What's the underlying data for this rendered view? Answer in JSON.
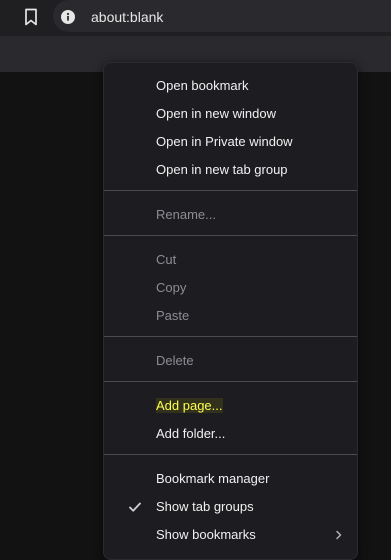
{
  "toolbar": {
    "url": "about:blank",
    "bookmark_icon": "bookmark-icon",
    "info_icon": "info-icon"
  },
  "menu": {
    "group1": [
      "Open bookmark",
      "Open in new window",
      "Open in Private window",
      "Open in new tab group"
    ],
    "rename": "Rename...",
    "edit": [
      "Cut",
      "Copy",
      "Paste"
    ],
    "delete": "Delete",
    "add": [
      "Add page...",
      "Add folder..."
    ],
    "bottom": [
      "Bookmark manager",
      "Show tab groups",
      "Show bookmarks"
    ],
    "checked_item": "Show tab groups",
    "submenu_item": "Show bookmarks"
  },
  "colors": {
    "menu_bg": "#1d1d21",
    "highlight": "#ffff4d",
    "disabled": "#8c8c92"
  }
}
